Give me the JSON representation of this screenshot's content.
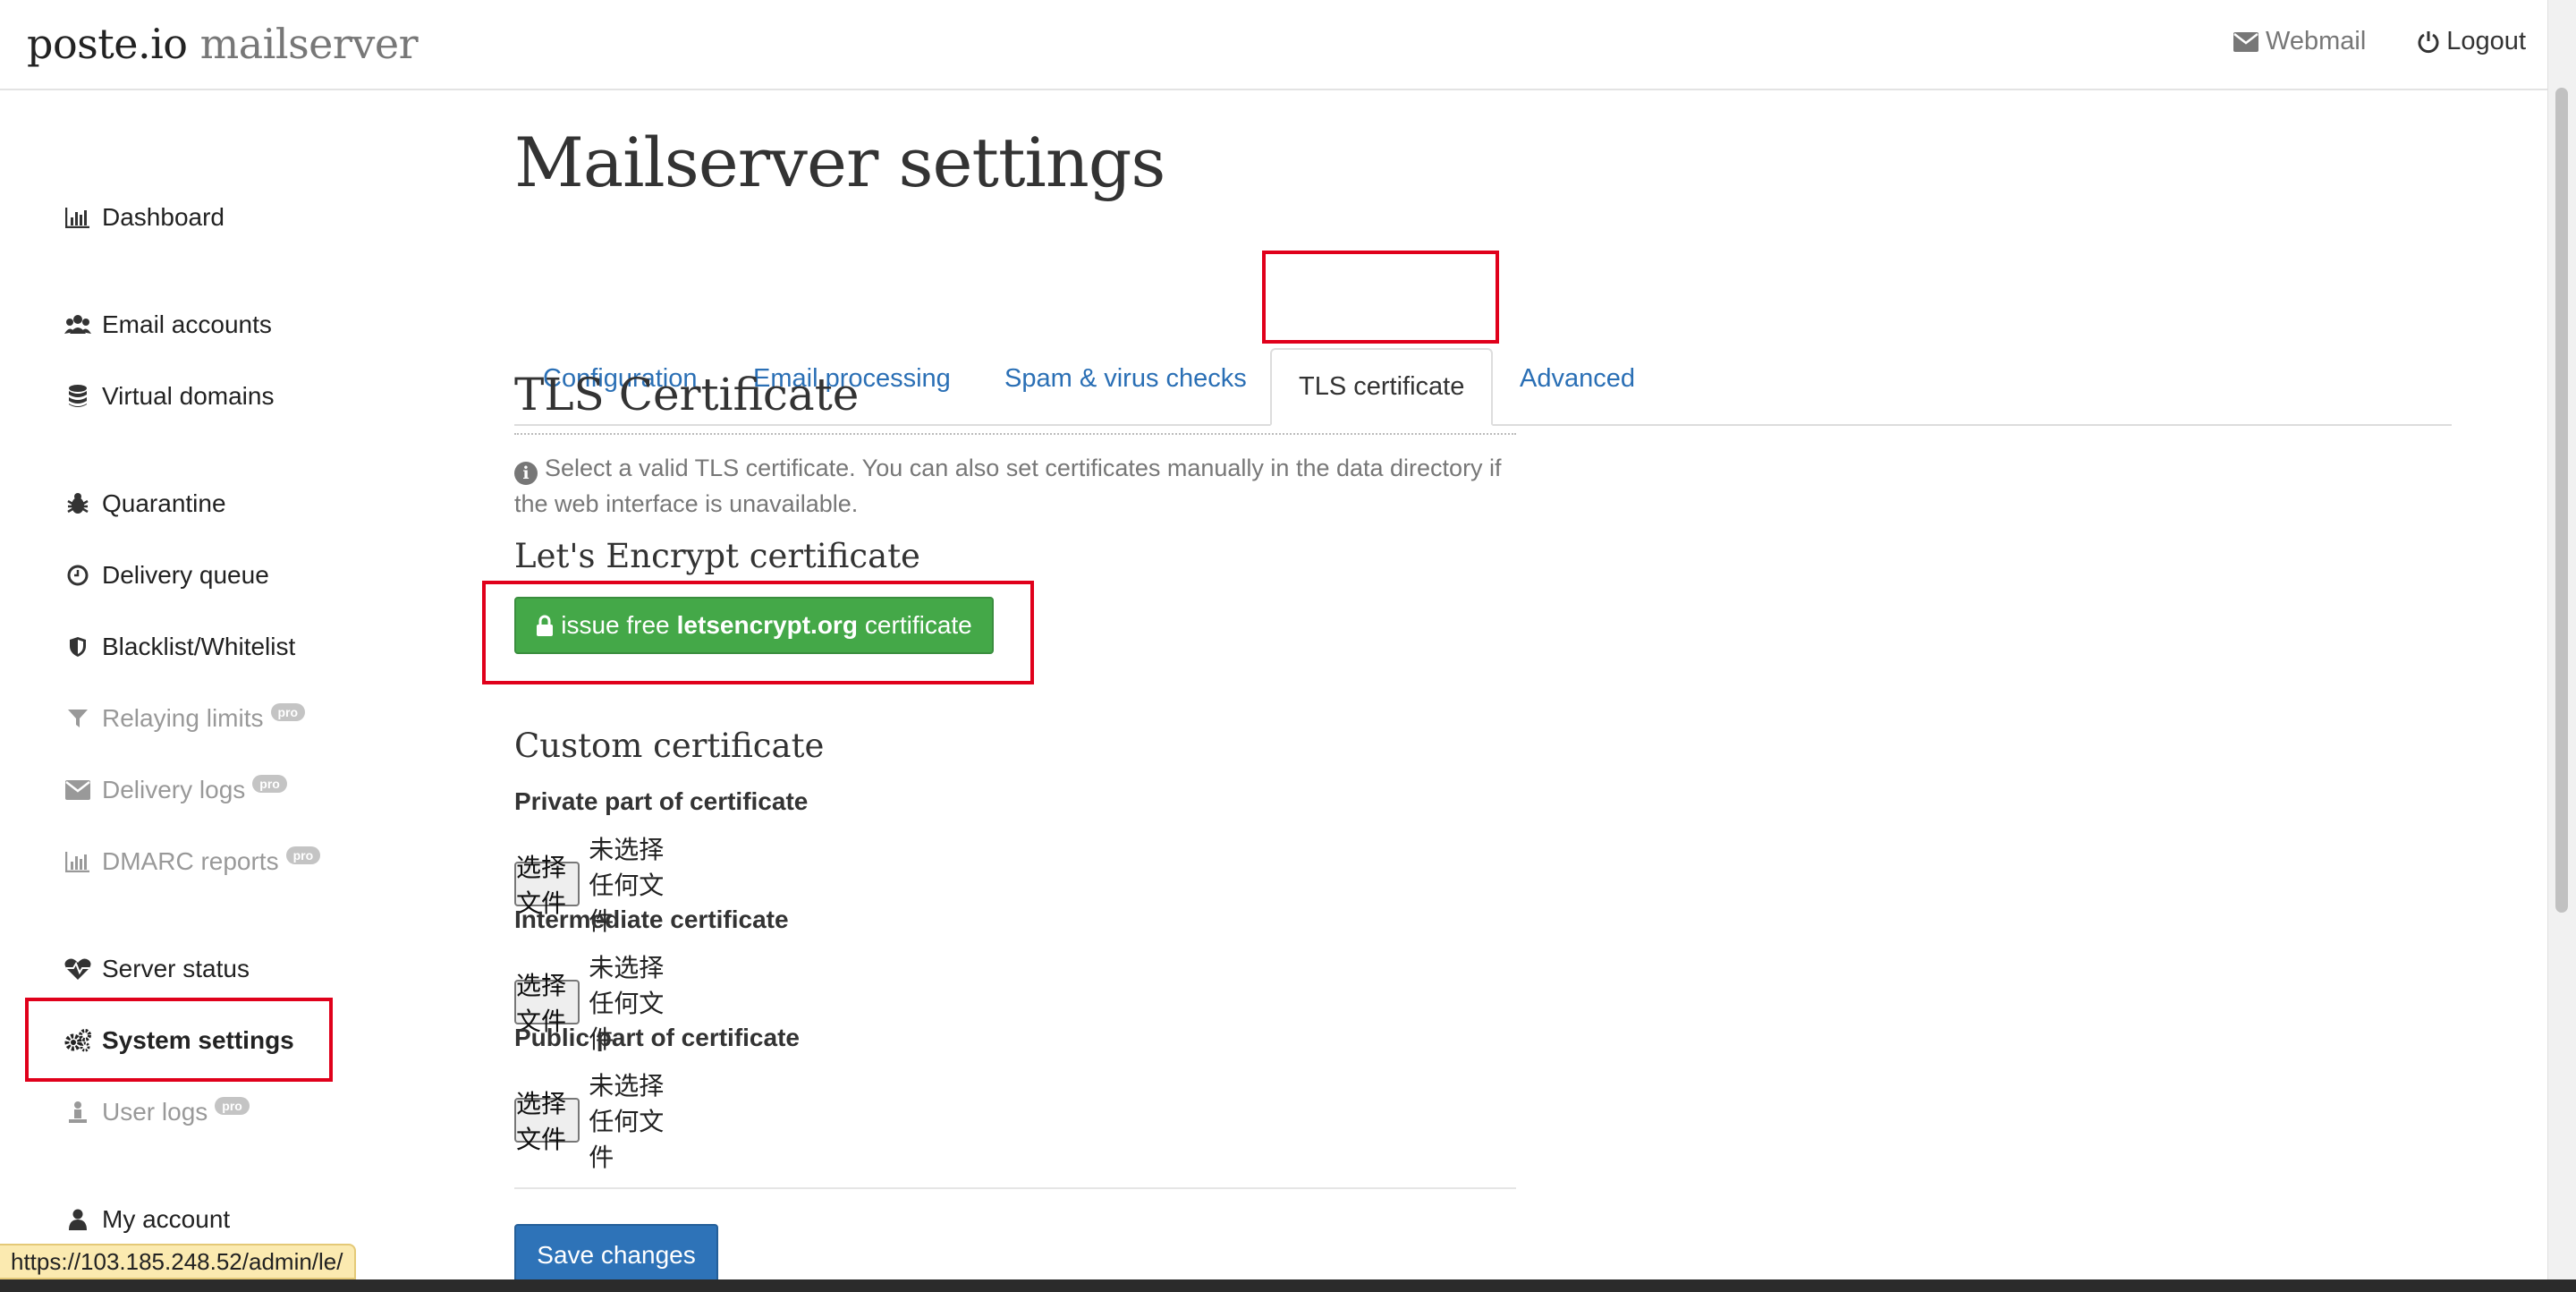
{
  "navbar": {
    "brand_main": "poste.io",
    "brand_sub": "mailserver",
    "webmail_label": "Webmail",
    "logout_label": "Logout"
  },
  "sidebar": {
    "items": [
      {
        "label": "Dashboard",
        "icon": "bar-chart-icon"
      },
      {
        "label": "Email accounts",
        "icon": "users-icon"
      },
      {
        "label": "Virtual domains",
        "icon": "database-icon"
      },
      {
        "label": "Quarantine",
        "icon": "bug-icon"
      },
      {
        "label": "Delivery queue",
        "icon": "clock-icon"
      },
      {
        "label": "Blacklist/Whitelist",
        "icon": "shield-icon"
      },
      {
        "label": "Relaying limits",
        "icon": "filter-icon",
        "badge": "pro"
      },
      {
        "label": "Delivery logs",
        "icon": "envelope-icon",
        "badge": "pro"
      },
      {
        "label": "DMARC reports",
        "icon": "bar-chart-icon",
        "badge": "pro"
      },
      {
        "label": "Server status",
        "icon": "heartbeat-icon"
      },
      {
        "label": "System settings",
        "icon": "gears-icon"
      },
      {
        "label": "User logs",
        "icon": "user-log-icon",
        "badge": "pro"
      },
      {
        "label": "My account",
        "icon": "user-icon"
      }
    ]
  },
  "main": {
    "title": "Mailserver settings",
    "tabs": [
      {
        "label": "Configuration"
      },
      {
        "label": "Email processing"
      },
      {
        "label": "Spam & virus checks"
      },
      {
        "label": "TLS certificate",
        "active": true
      },
      {
        "label": "Advanced"
      }
    ],
    "section_title": "TLS Certificate",
    "help_text": "Select a valid TLS certificate. You can also set certificates manually in the data directory if the web interface is unavailable.",
    "letsencrypt_title": "Let's Encrypt certificate",
    "letsencrypt_button": {
      "prefix": "issue free",
      "bold": "letsencrypt.org",
      "suffix": "certificate"
    },
    "custom_title": "Custom certificate",
    "fields": [
      {
        "label": "Private part of certificate",
        "button": "选择文件",
        "status": "未选择任何文件"
      },
      {
        "label": "Intermediate certificate",
        "button": "选择文件",
        "status": "未选择任何文件"
      },
      {
        "label": "Public part of certificate",
        "button": "选择文件",
        "status": "未选择任何文件"
      }
    ],
    "save_label": "Save changes"
  },
  "status_url": "https://103.185.248.52/admin/le/",
  "colors": {
    "link": "#2a6fb5",
    "success": "#44a848",
    "primary": "#2e73b8",
    "highlight": "#e0001b"
  }
}
